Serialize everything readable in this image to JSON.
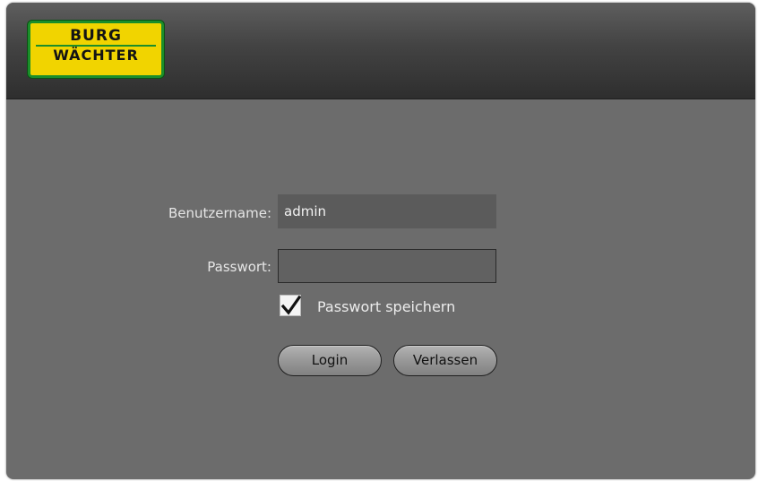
{
  "logo": {
    "line1": "BURG",
    "line2": "WÄCHTER"
  },
  "form": {
    "username_label": "Benutzername:",
    "username_value": "admin",
    "password_label": "Passwort:",
    "password_value": "",
    "remember_label": "Passwort speichern",
    "remember_checked": true,
    "login_label": "Login",
    "leave_label": "Verlassen"
  },
  "colors": {
    "header_dark": "#2e2e2e",
    "body_bg": "#6c6c6c",
    "logo_yellow": "#f1d400",
    "logo_green": "#1b8e2a"
  }
}
